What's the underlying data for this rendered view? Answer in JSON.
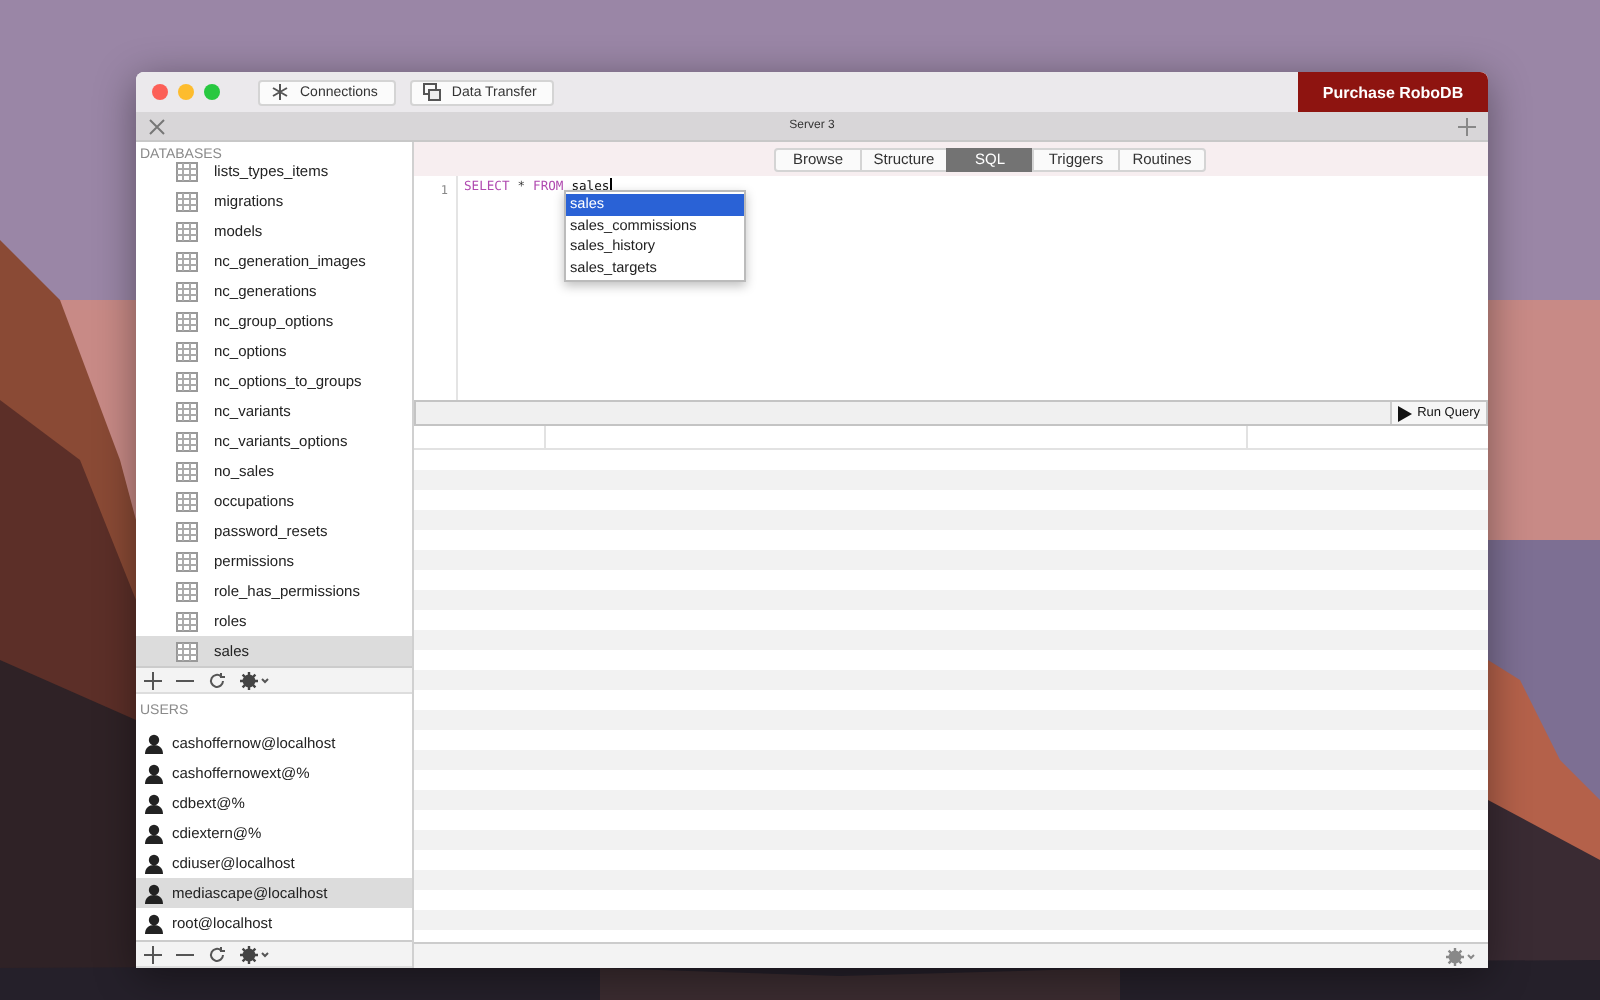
{
  "toolbar": {
    "buttons": [
      {
        "kind": "connections",
        "label": "Connections"
      },
      {
        "kind": "transfer",
        "label": "Data Transfer"
      }
    ],
    "purchase": "Purchase RoboDB"
  },
  "window": {
    "title": "Server 3"
  },
  "sidebar": {
    "databases_header": "DATABASES",
    "tables": [
      {
        "name": "lists_types_items",
        "selected": false
      },
      {
        "name": "migrations",
        "selected": false
      },
      {
        "name": "models",
        "selected": false
      },
      {
        "name": "nc_generation_images",
        "selected": false
      },
      {
        "name": "nc_generations",
        "selected": false
      },
      {
        "name": "nc_group_options",
        "selected": false
      },
      {
        "name": "nc_options",
        "selected": false
      },
      {
        "name": "nc_options_to_groups",
        "selected": false
      },
      {
        "name": "nc_variants",
        "selected": false
      },
      {
        "name": "nc_variants_options",
        "selected": false
      },
      {
        "name": "no_sales",
        "selected": false
      },
      {
        "name": "occupations",
        "selected": false
      },
      {
        "name": "password_resets",
        "selected": false
      },
      {
        "name": "permissions",
        "selected": false
      },
      {
        "name": "role_has_permissions",
        "selected": false
      },
      {
        "name": "roles",
        "selected": false
      },
      {
        "name": "sales",
        "selected": true
      }
    ],
    "users_header": "USERS",
    "users": [
      {
        "name": "cashoffernow@localhost",
        "selected": false
      },
      {
        "name": "cashoffernowext@%",
        "selected": false
      },
      {
        "name": "cdbext@%",
        "selected": false
      },
      {
        "name": "cdiextern@%",
        "selected": false
      },
      {
        "name": "cdiuser@localhost",
        "selected": false
      },
      {
        "name": "mediascape@localhost",
        "selected": true
      },
      {
        "name": "root@localhost",
        "selected": false
      }
    ]
  },
  "tabs": [
    {
      "label": "Browse",
      "selected": false
    },
    {
      "label": "Structure",
      "selected": false
    },
    {
      "label": "SQL",
      "selected": true
    },
    {
      "label": "Triggers",
      "selected": false
    },
    {
      "label": "Routines",
      "selected": false
    }
  ],
  "editor": {
    "line_number": "1",
    "tokens": [
      {
        "kind": "keyword",
        "text": "SELECT"
      },
      {
        "kind": "operator",
        "text": "*"
      },
      {
        "kind": "keyword",
        "text": "FROM"
      },
      {
        "kind": "identifier",
        "text": "sales"
      }
    ],
    "autocomplete": [
      {
        "label": "sales",
        "selected": true
      },
      {
        "label": "sales_commissions",
        "selected": false
      },
      {
        "label": "sales_history",
        "selected": false
      },
      {
        "label": "sales_targets",
        "selected": false
      }
    ]
  },
  "run_button": "Run Query"
}
